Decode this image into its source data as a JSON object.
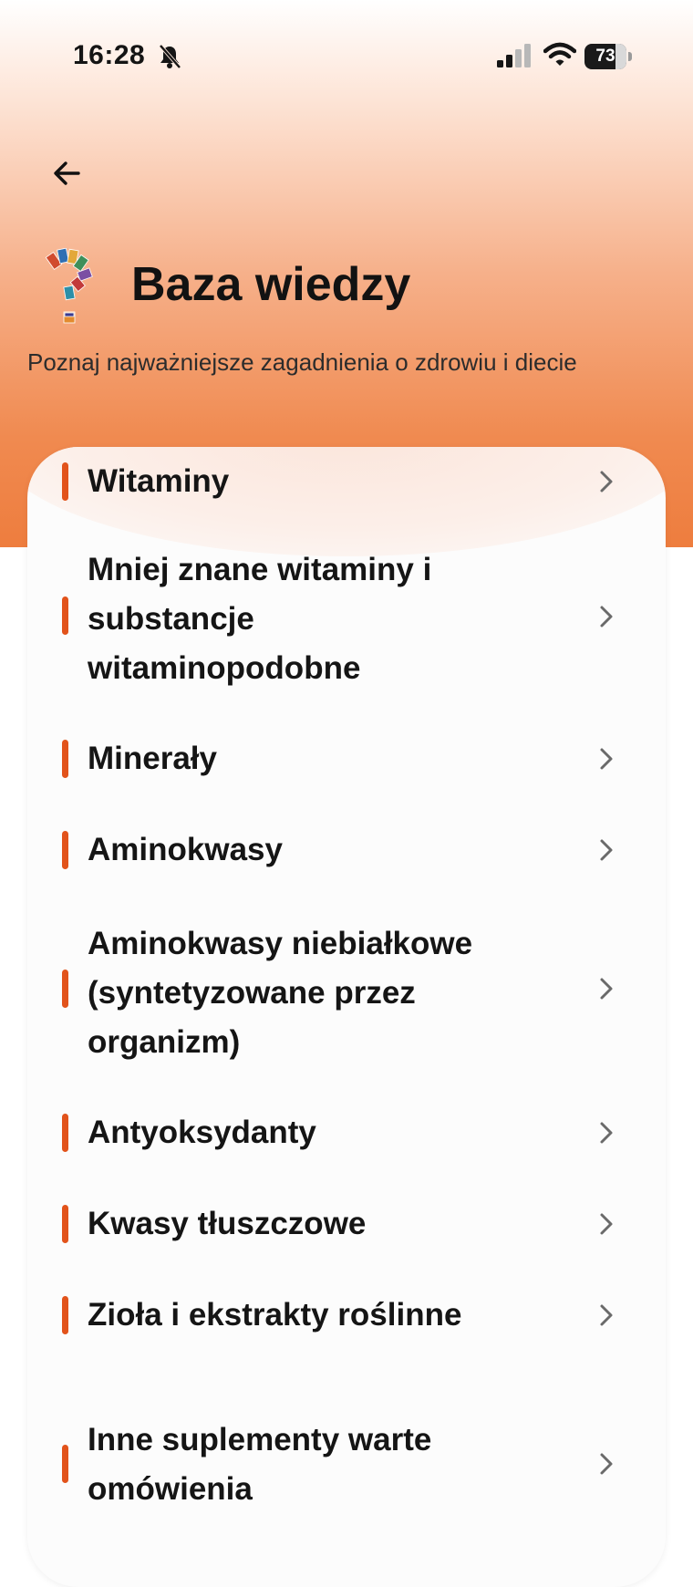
{
  "status_bar": {
    "time": "16:28",
    "battery": "73",
    "icons": [
      "bell-slash-icon",
      "signal-icon",
      "wifi-icon",
      "battery-icon"
    ]
  },
  "header": {
    "title": "Baza wiedzy",
    "subtitle": "Poznaj najważniejsze zagadnienia o zdrowiu i diecie",
    "back_icon": "arrow-left-icon",
    "title_icon": "question-mark-books-icon"
  },
  "colors": {
    "accent": "#e2531b",
    "header_gradient_end": "#ee7d3e"
  },
  "topics": [
    {
      "label": "Witaminy"
    },
    {
      "label": "Mniej znane witaminy i substancje witaminopodobne"
    },
    {
      "label": "Minerały"
    },
    {
      "label": "Aminokwasy"
    },
    {
      "label": "Aminokwasy niebiałkowe (syntetyzowane przez organizm)"
    },
    {
      "label": "Antyoksydanty"
    },
    {
      "label": "Kwasy tłuszczowe"
    },
    {
      "label": "Zioła i ekstrakty roślinne"
    },
    {
      "label": "Inne suplementy warte omówienia"
    }
  ]
}
